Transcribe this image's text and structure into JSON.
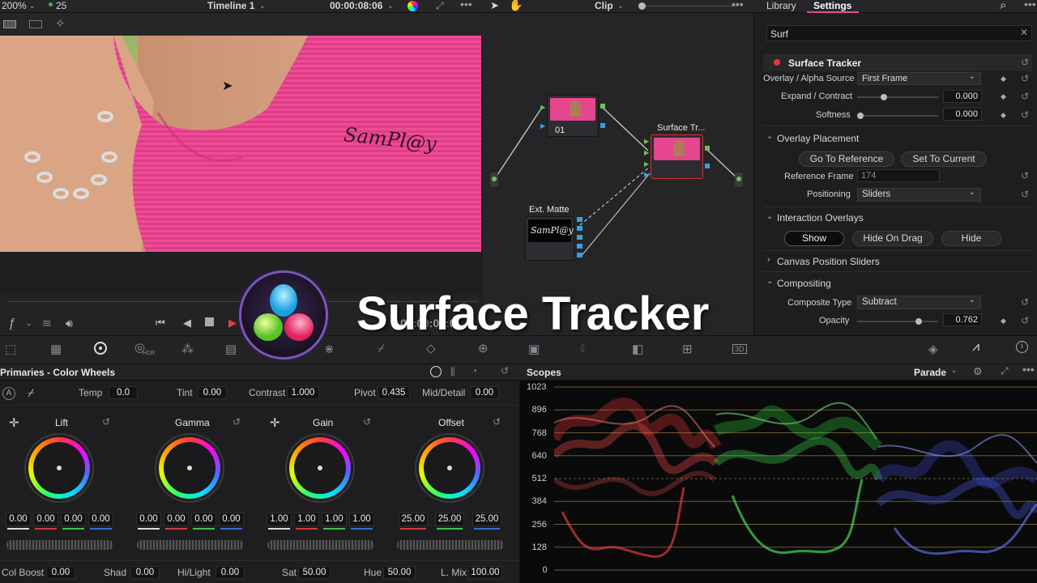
{
  "topbar": {
    "zoom": "200%",
    "fps": "25",
    "timeline": "Timeline 1",
    "timecode": "00:00:08:06",
    "clip_label": "Clip",
    "tab_library": "Library",
    "tab_settings": "Settings"
  },
  "viewer": {
    "watermark": "SamPl@y",
    "timecode_overlay": "00:00:07:0"
  },
  "nodes": {
    "node1_label": "01",
    "node2_label": "Surface Tr...",
    "node3_label": "Ext. Matte",
    "matte_text": "SamPl@y"
  },
  "inspector": {
    "search_value": "Surf",
    "effect_name": "Surface Tracker",
    "overlay_alpha_label": "Overlay / Alpha Source",
    "overlay_alpha_value": "First Frame",
    "expand_label": "Expand / Contract",
    "expand_value": "0.000",
    "softness_label": "Softness",
    "softness_value": "0.000",
    "overlay_placement": "Overlay Placement",
    "go_to_reference": "Go To Reference",
    "set_to_current": "Set To Current",
    "reference_frame_label": "Reference Frame",
    "reference_frame_value": "174",
    "positioning_label": "Positioning",
    "positioning_value": "Sliders",
    "interaction_overlays": "Interaction Overlays",
    "show": "Show",
    "hide_on_drag": "Hide On Drag",
    "hide": "Hide",
    "canvas_position_sliders": "Canvas Position Sliders",
    "compositing": "Compositing",
    "composite_type_label": "Composite Type",
    "composite_type_value": "Subtract",
    "opacity_label": "Opacity",
    "opacity_value": "0.762"
  },
  "palette": {
    "hdr_label": "HDR",
    "three_d_label": "3D"
  },
  "wheels": {
    "header": "Primaries - Color Wheels",
    "temp_label": "Temp",
    "temp": "0.0",
    "tint_label": "Tint",
    "tint": "0.00",
    "contrast_label": "Contrast",
    "contrast": "1.000",
    "pivot_label": "Pivot",
    "pivot": "0.435",
    "mid_label": "Mid/Detail",
    "mid": "0.00",
    "lift_label": "Lift",
    "gamma_label": "Gamma",
    "gain_label": "Gain",
    "offset_label": "Offset",
    "lift_vals": [
      "0.00",
      "0.00",
      "0.00",
      "0.00"
    ],
    "gamma_vals": [
      "0.00",
      "0.00",
      "0.00",
      "0.00"
    ],
    "gain_vals": [
      "1.00",
      "1.00",
      "1.00",
      "1.00"
    ],
    "offset_vals": [
      "25.00",
      "25.00",
      "25.00"
    ],
    "colboost_label": "Col Boost",
    "colboost": "0.00",
    "shad_label": "Shad",
    "shad": "0.00",
    "hilight_label": "Hi/Light",
    "hilight": "0.00",
    "sat_label": "Sat",
    "sat": "50.00",
    "hue_label": "Hue",
    "hue": "50.00",
    "lmix_label": "L. Mix",
    "lmix": "100.00"
  },
  "scopes": {
    "header": "Scopes",
    "mode": "Parade",
    "ticks": [
      "1023",
      "896",
      "768",
      "640",
      "512",
      "384",
      "256",
      "128",
      "0"
    ]
  },
  "overlay": {
    "title": "Surface Tracker"
  },
  "colors": {
    "accent": "#e64c8f",
    "selected_node": "#d63030"
  }
}
